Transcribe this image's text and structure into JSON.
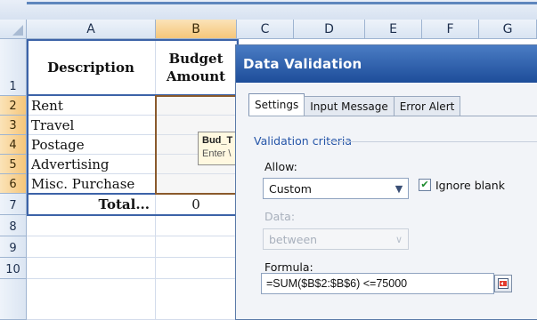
{
  "columns": [
    "A",
    "B",
    "C",
    "D",
    "E",
    "F",
    "G"
  ],
  "selected_column": "B",
  "rows": [
    "1",
    "2",
    "3",
    "4",
    "5",
    "6",
    "7",
    "8",
    "9",
    "10"
  ],
  "table": {
    "header_description": "Description",
    "header_budget": "Budget Amount",
    "items": [
      "Rent",
      "Travel",
      "Postage",
      "Advertising",
      "Misc. Purchase"
    ],
    "total_label": "Total...",
    "total_value": "0"
  },
  "tooltip": {
    "line1": "Bud_T",
    "line2": "Enter \\"
  },
  "dialog": {
    "title": "Data Validation",
    "tabs": [
      "Settings",
      "Input Message",
      "Error Alert"
    ],
    "active_tab": "Settings",
    "section_label": "Validation criteria",
    "allow_label": "Allow:",
    "allow_value": "Custom",
    "ignore_blank_label": "Ignore blank",
    "ignore_blank_checked": true,
    "data_label": "Data:",
    "data_value": "between",
    "formula_label": "Formula:",
    "formula_value": "=SUM($B$2:$B$6) <=75000"
  },
  "icons": {
    "dropdown": "chevron-down-icon",
    "checkbox": "check-icon",
    "range_ref": "range-selector-icon"
  },
  "colors": {
    "title_bar": "#1d4d9a",
    "selected_header": "#f5c67a",
    "table_border": "#3c63a8"
  }
}
